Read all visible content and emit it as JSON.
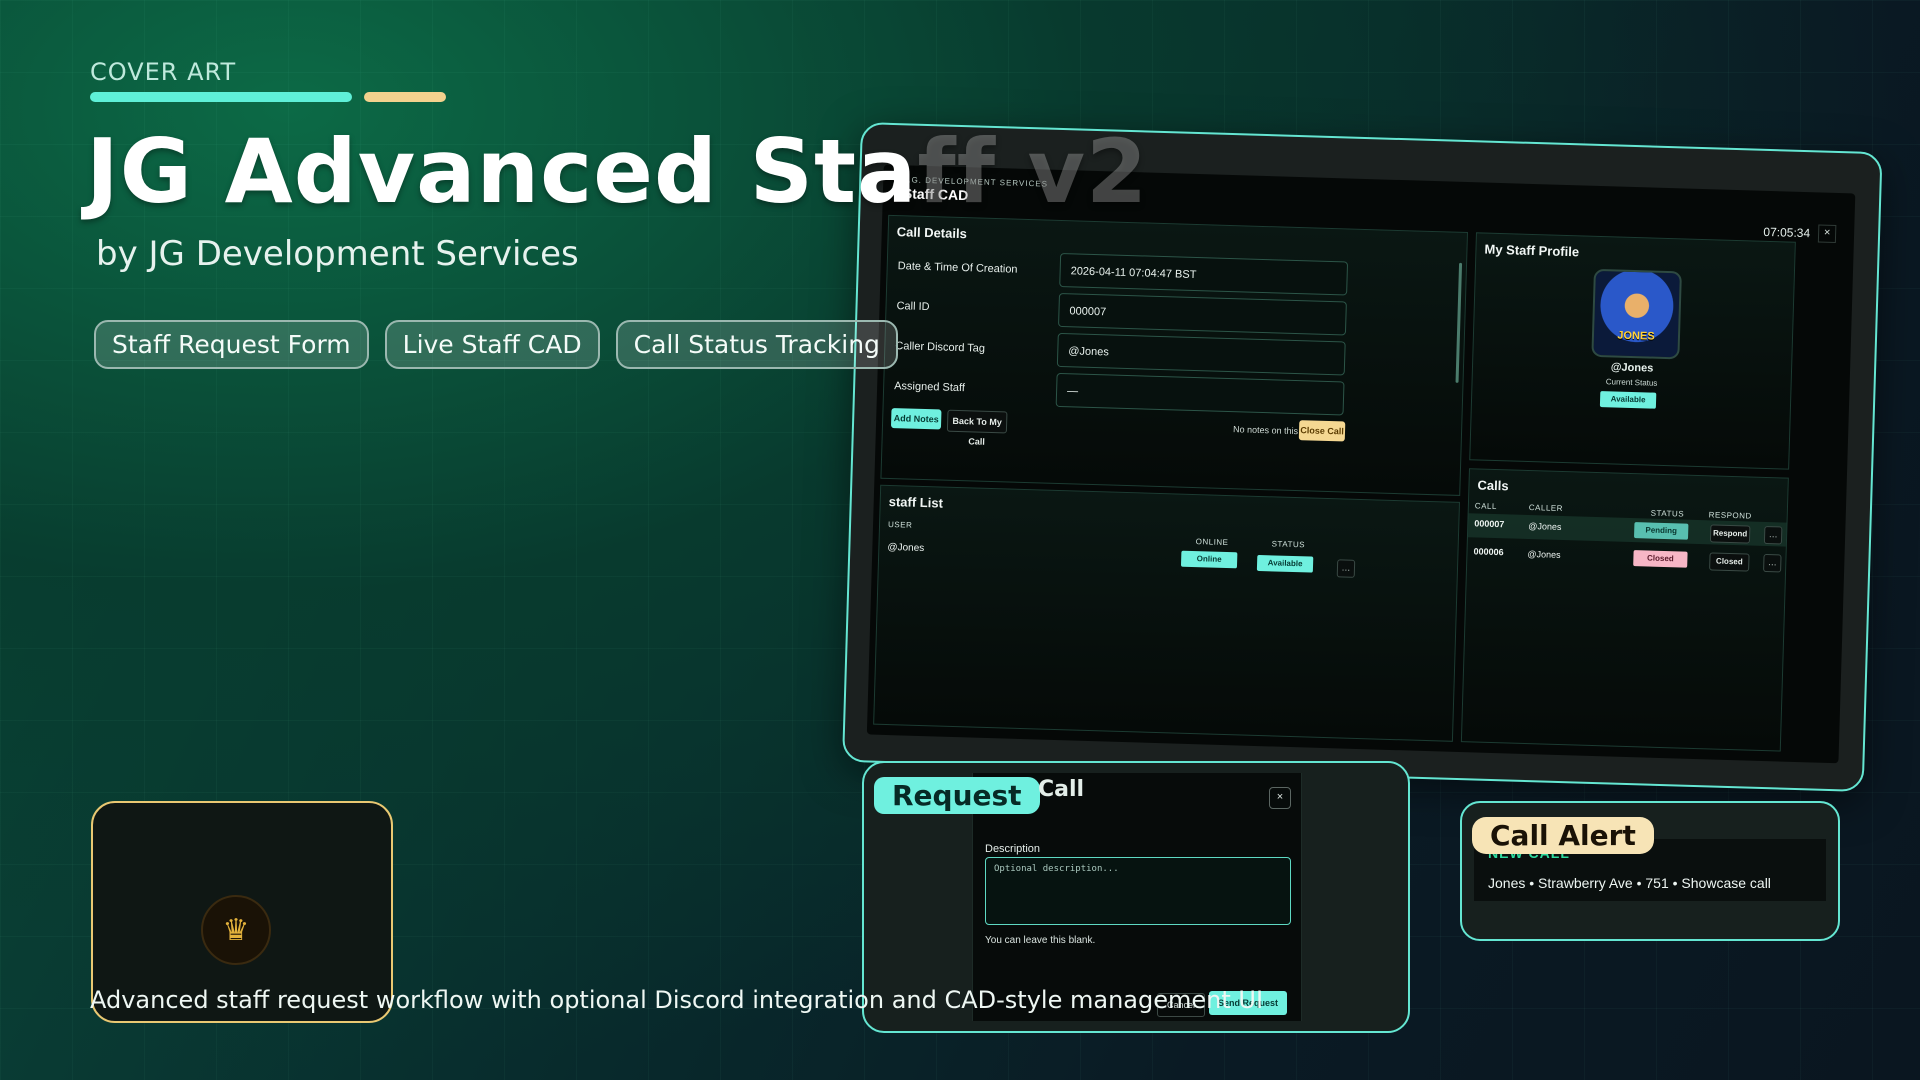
{
  "cover": {
    "kicker": "COVER ART",
    "title_main": "JG Advanced Sta",
    "title_ghost": "ff v2",
    "byline": "by JG Development Services",
    "features": [
      "Staff Request Form",
      "Live Staff CAD",
      "Call Status Tracking"
    ],
    "description": "Advanced staff request workflow with optional Discord integration and CAD-style management UI",
    "accent": "#5ff0d8",
    "accent2": "#f3d28e"
  },
  "cad": {
    "brand_small": "J.G. DEVELOPMENT SERVICES",
    "brand_title": "Staff CAD",
    "clock": "07:05:34",
    "close": "×",
    "call_details": {
      "title": "Call Details",
      "fields": [
        {
          "label": "Date & Time Of Creation",
          "value": "2026-04-11 07:04:47 BST"
        },
        {
          "label": "Call ID",
          "value": "000007"
        },
        {
          "label": "Caller Discord Tag",
          "value": "@Jones"
        },
        {
          "label": "Assigned Staff",
          "value": "—"
        }
      ],
      "add_notes": "Add Notes",
      "back_to_call": "Back To My Call",
      "no_notes": "No notes on this call.",
      "close_call": "Close Call"
    },
    "profile": {
      "title": "My Staff Profile",
      "avatar_text": "JONES",
      "name": "@Jones",
      "status_label": "Current Status",
      "status": "Available"
    },
    "staff_list": {
      "title": "staff List",
      "headers": {
        "user": "USER",
        "online": "ONLINE",
        "status": "STATUS"
      },
      "rows": [
        {
          "user": "@Jones",
          "online": "Online",
          "status": "Available",
          "more": "…"
        }
      ]
    },
    "calls": {
      "title": "Calls",
      "headers": {
        "call": "CALL",
        "caller": "CALLER",
        "status": "STATUS",
        "respond": "RESPOND"
      },
      "rows": [
        {
          "call": "000007",
          "caller": "@Jones",
          "status": "Pending",
          "respond": "Respond",
          "more": "…"
        },
        {
          "call": "000006",
          "caller": "@Jones",
          "status": "Closed",
          "respond": "Closed",
          "more": "…"
        }
      ]
    }
  },
  "request": {
    "tag": "Request",
    "tag_tail": "Call",
    "close": "×",
    "description_label": "Description",
    "placeholder": "Optional description...",
    "help": "You can leave this blank.",
    "cancel": "Cancel",
    "send": "Send Request"
  },
  "alert": {
    "tag": "Call Alert",
    "header": "NEW CALL",
    "line": "Jones • Strawberry Ave • 751 • Showcase call"
  }
}
